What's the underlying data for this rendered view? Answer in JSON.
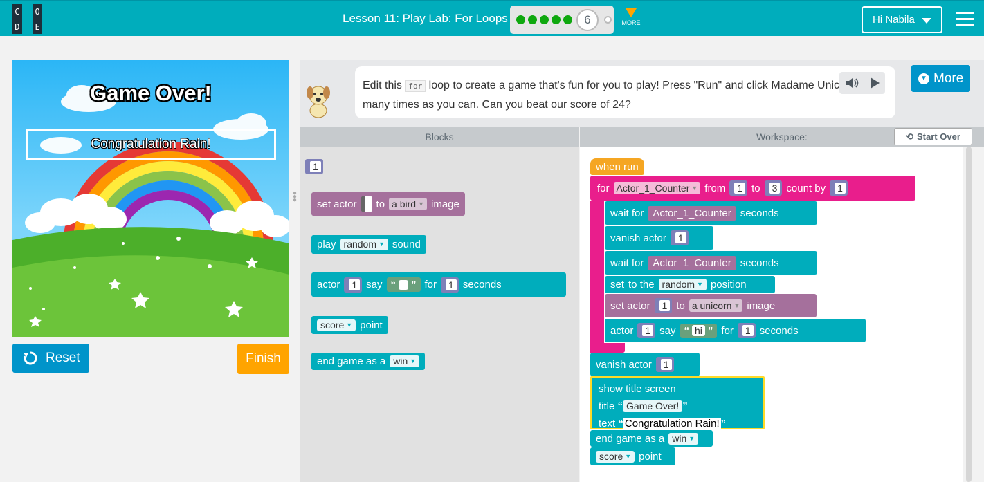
{
  "header": {
    "logo_letters": [
      "C",
      "O",
      "D",
      "E"
    ],
    "lesson_title": "Lesson 11: Play Lab: For Loops",
    "current_level": "6",
    "more_label": "MORE",
    "user_label": "Hi Nabila",
    "colors": {
      "header_bg": "#00adbc",
      "complete_dot": "#0fa80f",
      "more_arrow": "#ffa400"
    }
  },
  "stage": {
    "title": "Game Over!",
    "subtitle": "Congratulation Rain!"
  },
  "controls": {
    "reset_label": "Reset",
    "finish_label": "Finish"
  },
  "instructions": {
    "text_before": "Edit this ",
    "code": "for",
    "text_after": " loop to create a game that's fun for you to play! Press \"Run\" and click Madame Unicorn as many times as you can. Can you beat our score of 24?",
    "more_label": "More"
  },
  "panels": {
    "blocks_header": "Blocks",
    "workspace_header": "Workspace:",
    "start_over_label": "Start Over"
  },
  "toolbox": {
    "num_block": "1",
    "set_actor": {
      "prefix": "set actor",
      "mid": "to",
      "value": "a bird",
      "suffix": "image"
    },
    "play_sound": {
      "prefix": "play",
      "value": "random",
      "suffix": "sound"
    },
    "actor_say": {
      "prefix": "actor",
      "num": "1",
      "say": "say",
      "quote_open": "“",
      "quote_close": "”",
      "for": "for",
      "num2": "1",
      "suffix": "seconds"
    },
    "score_point": {
      "value": "score",
      "suffix": "point"
    },
    "end_game": {
      "prefix": "end game as a",
      "value": "win"
    }
  },
  "workspace": {
    "when_run": "when run",
    "for_loop": {
      "label": "for",
      "var": "Actor_1_Counter",
      "from": "from",
      "from_val": "1",
      "to": "to",
      "to_val": "3",
      "count_by": "count by",
      "by_val": "1"
    },
    "wait1": {
      "label": "wait for",
      "var": "Actor_1_Counter",
      "suffix": "seconds"
    },
    "vanish1": {
      "label": "vanish actor",
      "num": "1"
    },
    "wait2": {
      "label": "wait for",
      "var": "Actor_1_Counter",
      "suffix": "seconds"
    },
    "set_pos": {
      "label": "set",
      "mid": "to the",
      "value": "random",
      "suffix": "position"
    },
    "set_actor": {
      "label": "set actor",
      "num": "1",
      "mid": "to",
      "value": "a unicorn",
      "suffix": "image"
    },
    "actor_say": {
      "label": "actor",
      "num": "1",
      "say": "say",
      "quote_open": "“",
      "text": "hi",
      "quote_close": "”",
      "for": "for",
      "num2": "1",
      "suffix": "seconds"
    },
    "vanish2": {
      "label": "vanish actor",
      "num": "1"
    },
    "title_screen": {
      "label": "show title screen",
      "title_label": "title",
      "title_value": "Game Over!",
      "text_label": "text",
      "text_value": "Congratulation Rain!",
      "quote_open": "“",
      "quote_close": "”"
    },
    "end_game": {
      "label": "end game as a",
      "value": "win"
    },
    "score": {
      "value": "score",
      "suffix": "point"
    }
  }
}
